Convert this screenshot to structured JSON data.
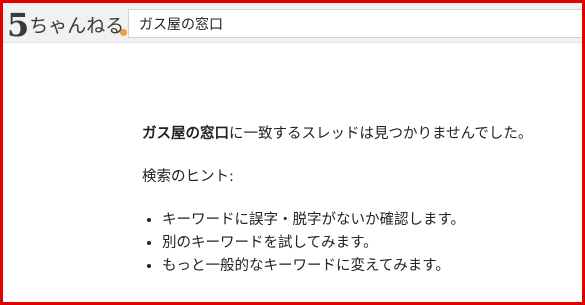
{
  "header": {
    "logo": {
      "number": "5",
      "text": "ちゃんねる"
    },
    "search": {
      "value": "ガス屋の窓口"
    }
  },
  "results": {
    "query": "ガス屋の窓口",
    "no_match_message": "に一致するスレッドは見つかりませんでした。",
    "hint_title": "検索のヒント:",
    "hints": [
      "キーワードに誤字・脱字がないか確認します。",
      "別のキーワードを試してみます。",
      "もっと一般的なキーワードに変えてみます。"
    ]
  },
  "colors": {
    "frame_border": "#e00000",
    "header_bg": "#f1f1f1",
    "logo_accent": "#f39a3a"
  }
}
